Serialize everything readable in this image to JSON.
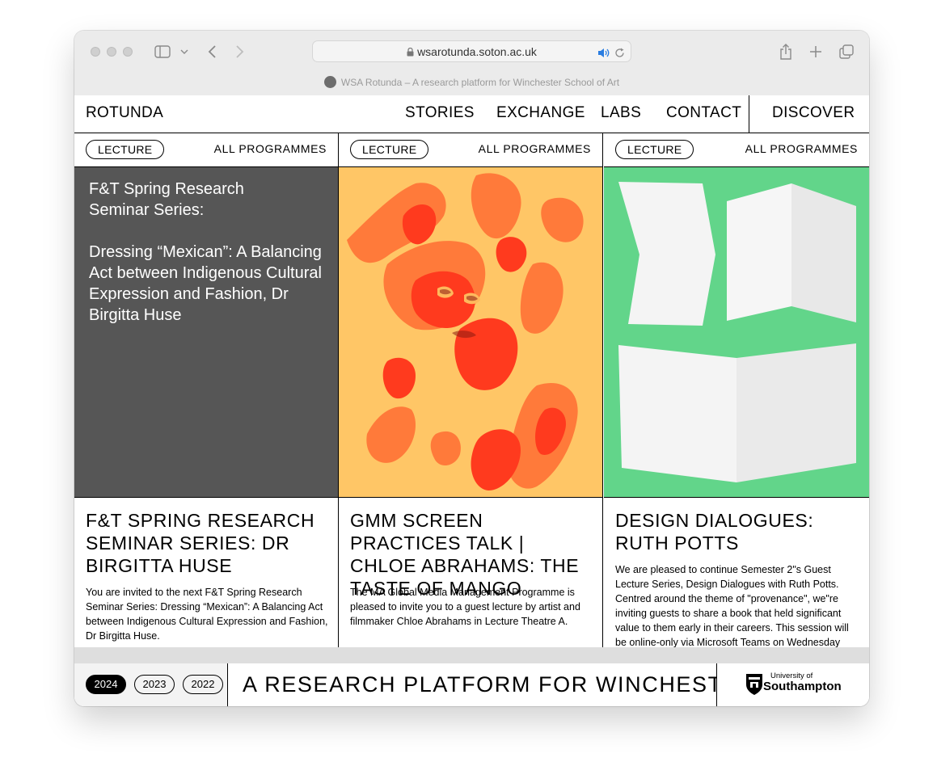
{
  "browser": {
    "url": "wsarotunda.soton.ac.uk",
    "tab_title": "WSA Rotunda – A research platform for Winchester School of Art"
  },
  "nav": {
    "logo": "ROTUNDA",
    "links": [
      "STORIES",
      "EXCHANGE",
      "LABS",
      "CONTACT"
    ],
    "discover": "DISCOVER"
  },
  "cards": [
    {
      "tag": "LECTURE",
      "all_programmes": "ALL PROGRAMMES",
      "poster_line1": "F&T Spring Research Seminar Series:",
      "poster_line2": "Dressing “Mexican”: A Balancing Act between Indigenous Cultural Expression and Fashion, Dr Birgitta Huse",
      "title": "F&T SPRING RESEARCH SEMINAR SERIES: DR BIRGITTA HUSE",
      "description": "You are invited to the next F&T Spring Research Seminar Series: Dressing “Mexican”: A Balancing Act between Indigenous Cultural Expression and Fashion, Dr Birgitta Huse."
    },
    {
      "tag": "LECTURE",
      "all_programmes": "ALL PROGRAMMES",
      "title": "GMM SCREEN PRACTICES TALK | CHLOE ABRAHAMS: THE TASTE OF MANGO",
      "description": "The MA Global Media Management Programme is pleased to invite you to a guest lecture by artist and filmmaker Chloe Abrahams in Lecture Theatre A."
    },
    {
      "tag": "LECTURE",
      "all_programmes": "ALL PROGRAMMES",
      "title": "DESIGN DIALOGUES: RUTH POTTS",
      "description": "We are pleased to continue Semester 2\"s Guest Lecture Series, Design Dialogues with Ruth Potts. Centred around the theme of \"provenance\", we\"re inviting guests to share a book that held significant value to them early in their careers. This session will be online-only via Microsoft Teams on Wednesday"
    }
  ],
  "footer": {
    "years": [
      "2024",
      "2023",
      "2022"
    ],
    "active_year": "2024",
    "ticker": "A RESEARCH PLATFORM FOR WINCHESTER",
    "university_small": "University of",
    "university_big": "Southampton"
  },
  "colors": {
    "grey_poster": "#565656",
    "orange_poster": "#ffc666",
    "green_poster": "#62d58a",
    "red_accent": "#ff2a14"
  }
}
